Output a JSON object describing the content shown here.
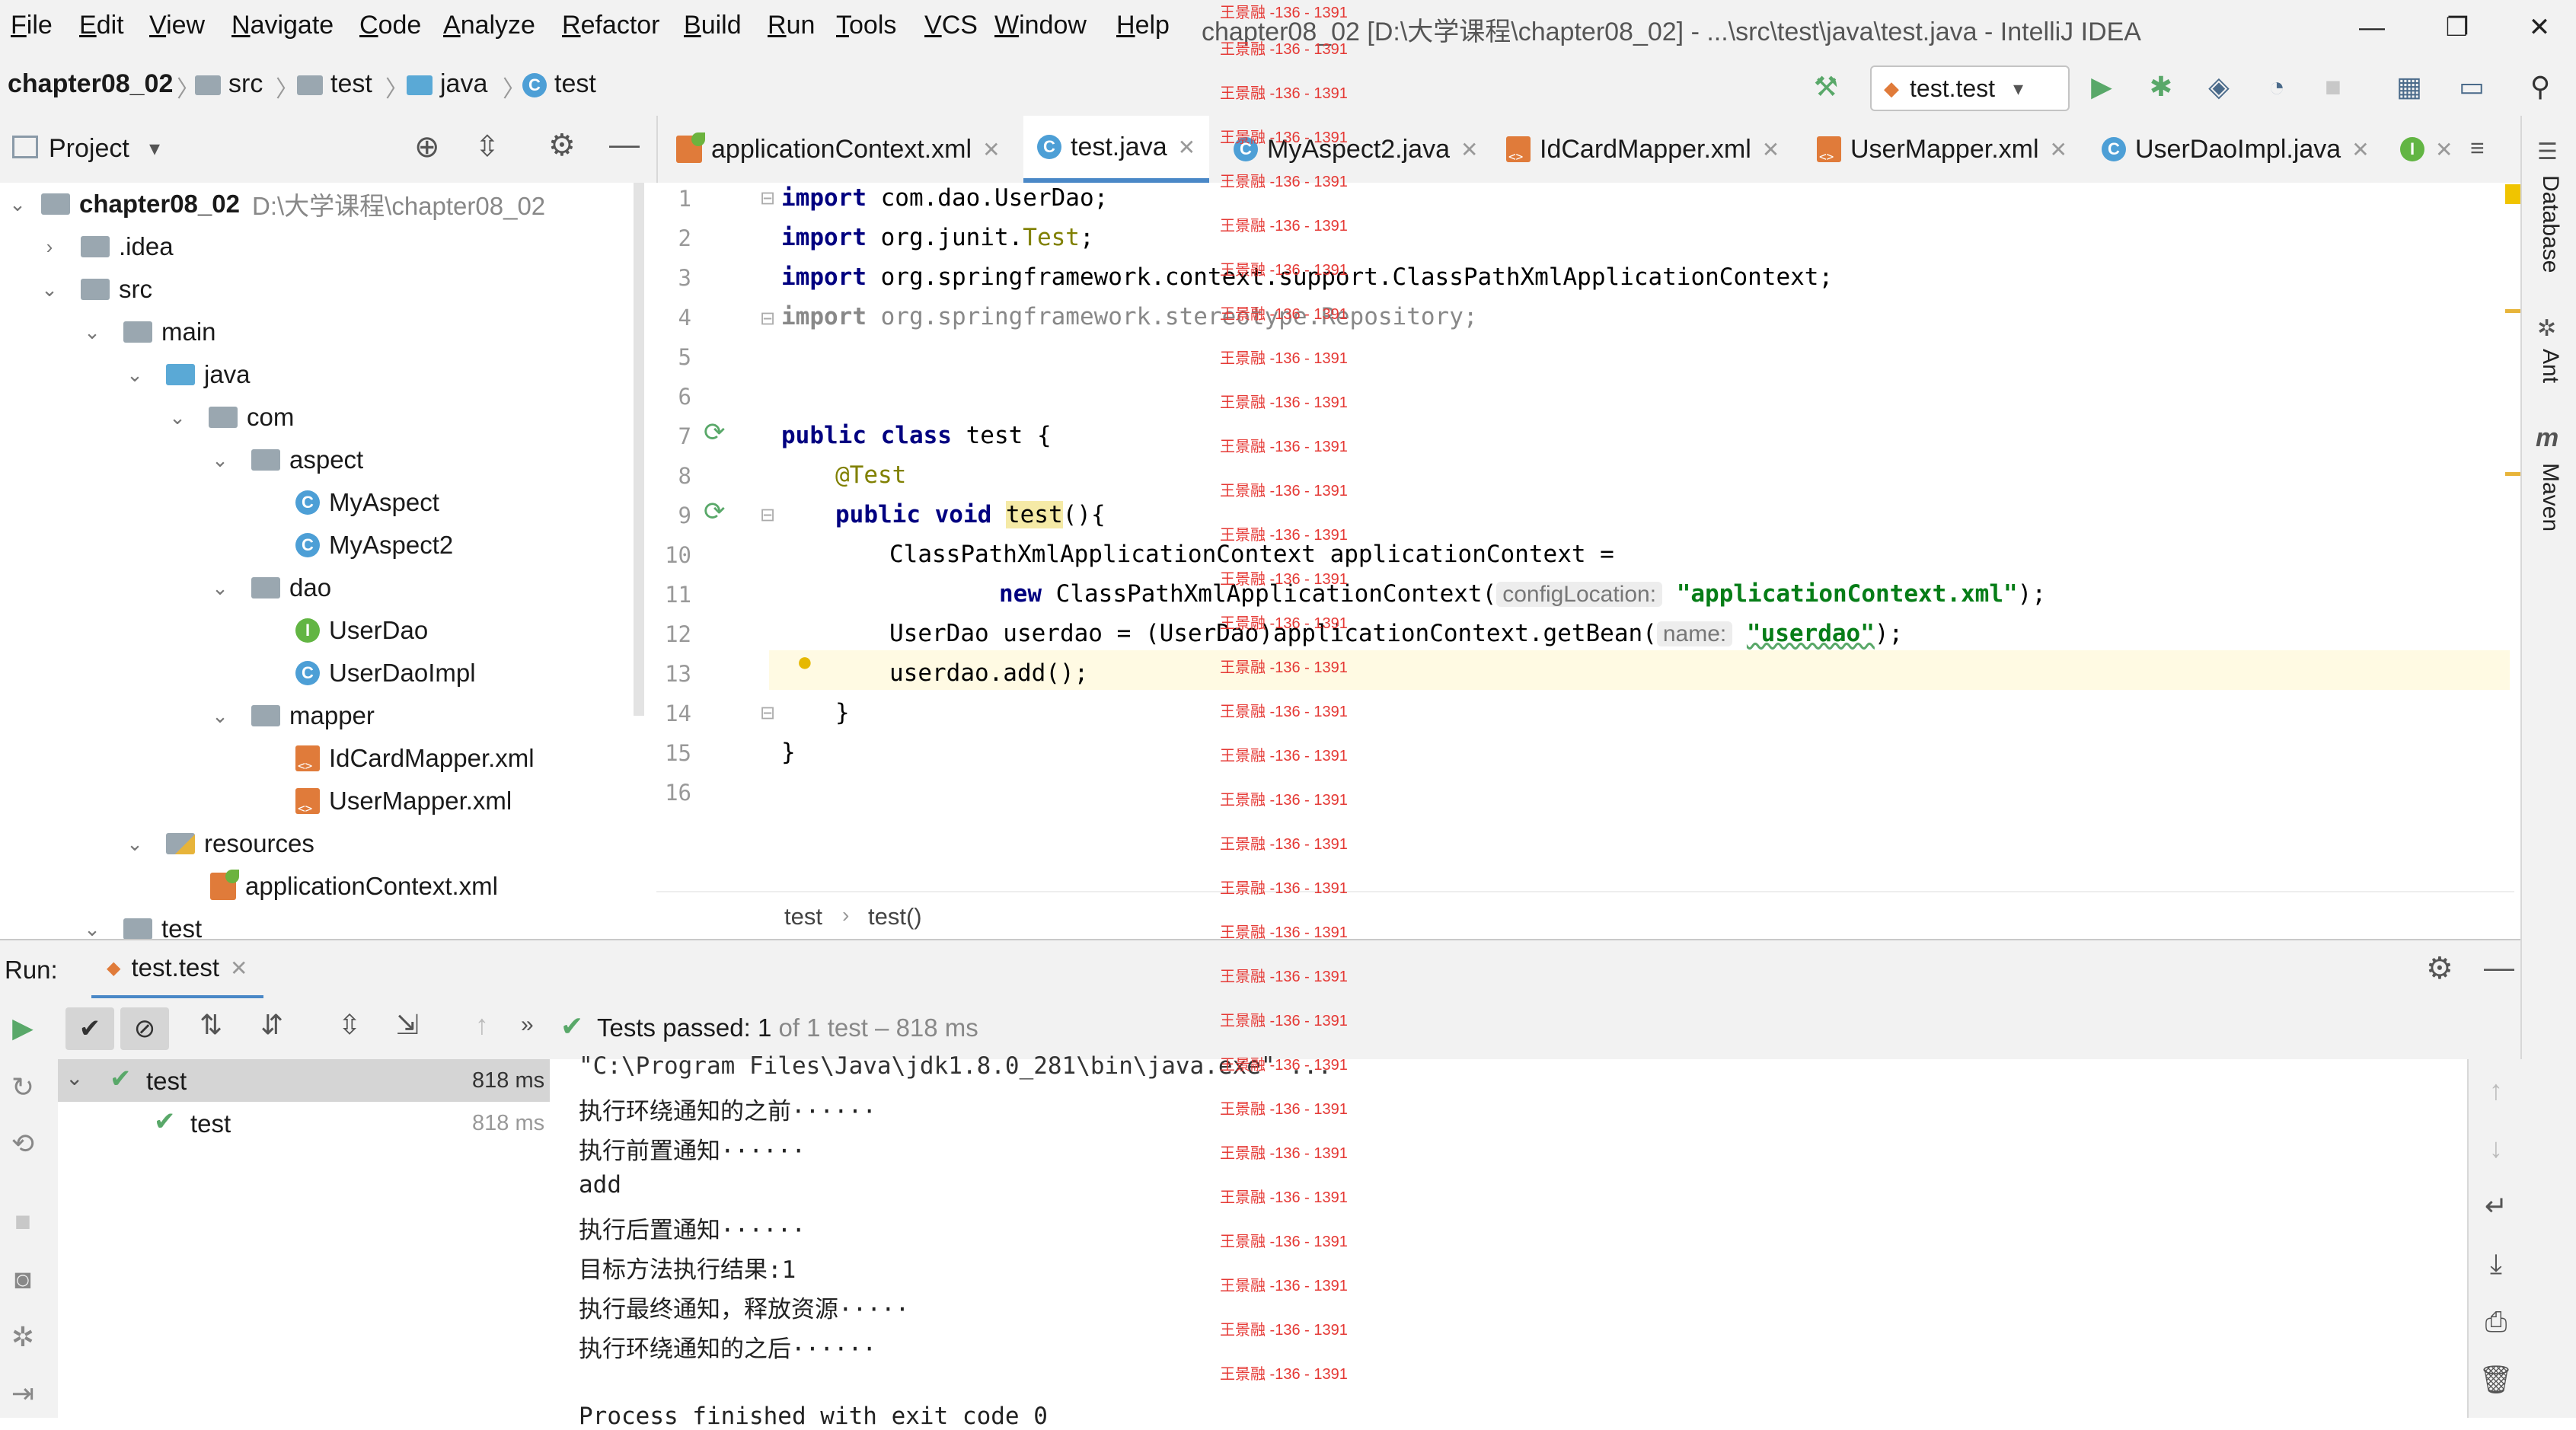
{
  "menu": [
    "File",
    "Edit",
    "View",
    "Navigate",
    "Code",
    "Analyze",
    "Refactor",
    "Build",
    "Run",
    "Tools",
    "VCS",
    "Window",
    "Help"
  ],
  "window_title": "chapter08_02 [D:\\大学课程\\chapter08_02] - ...\\src\\test\\java\\test.java - IntelliJ IDEA",
  "window_buttons": {
    "minimize": "—",
    "maximize": "❐",
    "close": "✕"
  },
  "breadcrumb": [
    "chapter08_02",
    "src",
    "test",
    "java",
    "test"
  ],
  "run_config": "test.test",
  "project_panel": {
    "title": "Project",
    "tree": [
      {
        "label": "chapter08_02",
        "extra": "D:\\大学课程\\chapter08_02",
        "icon": "module-folder-icon"
      },
      {
        "label": ".idea",
        "icon": "folder-icon"
      },
      {
        "label": "src",
        "icon": "folder-icon"
      },
      {
        "label": "main",
        "icon": "folder-icon"
      },
      {
        "label": "java",
        "icon": "source-folder-icon"
      },
      {
        "label": "com",
        "icon": "package-icon"
      },
      {
        "label": "aspect",
        "icon": "package-icon"
      },
      {
        "label": "MyAspect",
        "icon": "class-icon"
      },
      {
        "label": "MyAspect2",
        "icon": "class-icon"
      },
      {
        "label": "dao",
        "icon": "package-icon"
      },
      {
        "label": "UserDao",
        "icon": "interface-icon"
      },
      {
        "label": "UserDaoImpl",
        "icon": "class-icon"
      },
      {
        "label": "mapper",
        "icon": "package-icon"
      },
      {
        "label": "IdCardMapper.xml",
        "icon": "xml-file-icon"
      },
      {
        "label": "UserMapper.xml",
        "icon": "xml-file-icon"
      },
      {
        "label": "resources",
        "icon": "resources-folder-icon"
      },
      {
        "label": "applicationContext.xml",
        "icon": "spring-xml-icon"
      },
      {
        "label": "test",
        "icon": "folder-icon"
      }
    ]
  },
  "editor_tabs": [
    {
      "label": "applicationContext.xml",
      "icon": "spring-xml-icon"
    },
    {
      "label": "test.java",
      "icon": "class-icon",
      "active": true
    },
    {
      "label": "MyAspect2.java",
      "icon": "class-icon"
    },
    {
      "label": "IdCardMapper.xml",
      "icon": "xml-file-icon"
    },
    {
      "label": "UserMapper.xml",
      "icon": "xml-file-icon"
    },
    {
      "label": "UserDaoImpl.java",
      "icon": "class-icon"
    }
  ],
  "tab_overflow": "≡",
  "code": {
    "line_numbers": [
      "1",
      "2",
      "3",
      "4",
      "5",
      "6",
      "7",
      "8",
      "9",
      "10",
      "11",
      "12",
      "13",
      "14",
      "15",
      "16"
    ],
    "l1_kw": "import",
    "l1_rest": " com.dao.UserDao;",
    "l2_kw": "import",
    "l2_rest": " org.junit.",
    "l2_ann": "Test",
    "l2_end": ";",
    "l3_kw": "import",
    "l3_rest": " org.springframework.context.support.ClassPathXmlApplicationContext;",
    "l4_kw": "import",
    "l4_rest": " org.springframework.stereotype.Repository;",
    "l7_kw": "public class",
    "l7_rest": " test {",
    "l8_ann": "@Test",
    "l9_kw": "public void",
    "l9_name": "test",
    "l9_rest": "(){",
    "l10": "ClassPathXmlApplicationContext applicationContext =",
    "l11_kw": "new",
    "l11_rest": " ClassPathXmlApplicationContext(",
    "l11_hint": "configLocation:",
    "l11_str": "\"applicationContext.xml\"",
    "l11_end": ");",
    "l12_rest": "UserDao userdao = (UserDao)applicationContext.getBean(",
    "l12_hint": "name:",
    "l12_str": "\"userdao\"",
    "l12_end": ");",
    "l13": "userdao.add();",
    "l14": "}",
    "l15": "}"
  },
  "editor_breadcrumb": [
    "test",
    "test()"
  ],
  "right_tools": [
    "Database",
    "Ant",
    "Maven"
  ],
  "run_panel": {
    "label": "Run:",
    "tab": "test.test",
    "status_prefix": "Tests passed:",
    "status_count": "1",
    "status_suffix": "of 1 test – 818 ms",
    "test_tree": [
      {
        "label": "test",
        "time": "818 ms"
      },
      {
        "label": "test",
        "time": "818 ms"
      }
    ],
    "console": [
      "\"C:\\Program Files\\Java\\jdk1.8.0_281\\bin\\java.exe\" ...",
      "执行环绕通知的之前······",
      "执行前置通知······",
      "add",
      "执行后置通知······",
      "目标方法执行结果:1",
      "执行最终通知，释放资源·····",
      "执行环绕通知的之后······",
      "",
      "Process finished with exit code 0"
    ]
  },
  "watermark": "王景融 -136 - 1391",
  "colors": {
    "keyword": "#000080",
    "string": "#067d17",
    "annotation": "#808000",
    "accent": "#4a88c7",
    "pass": "#59a869",
    "run": "#59a869"
  }
}
